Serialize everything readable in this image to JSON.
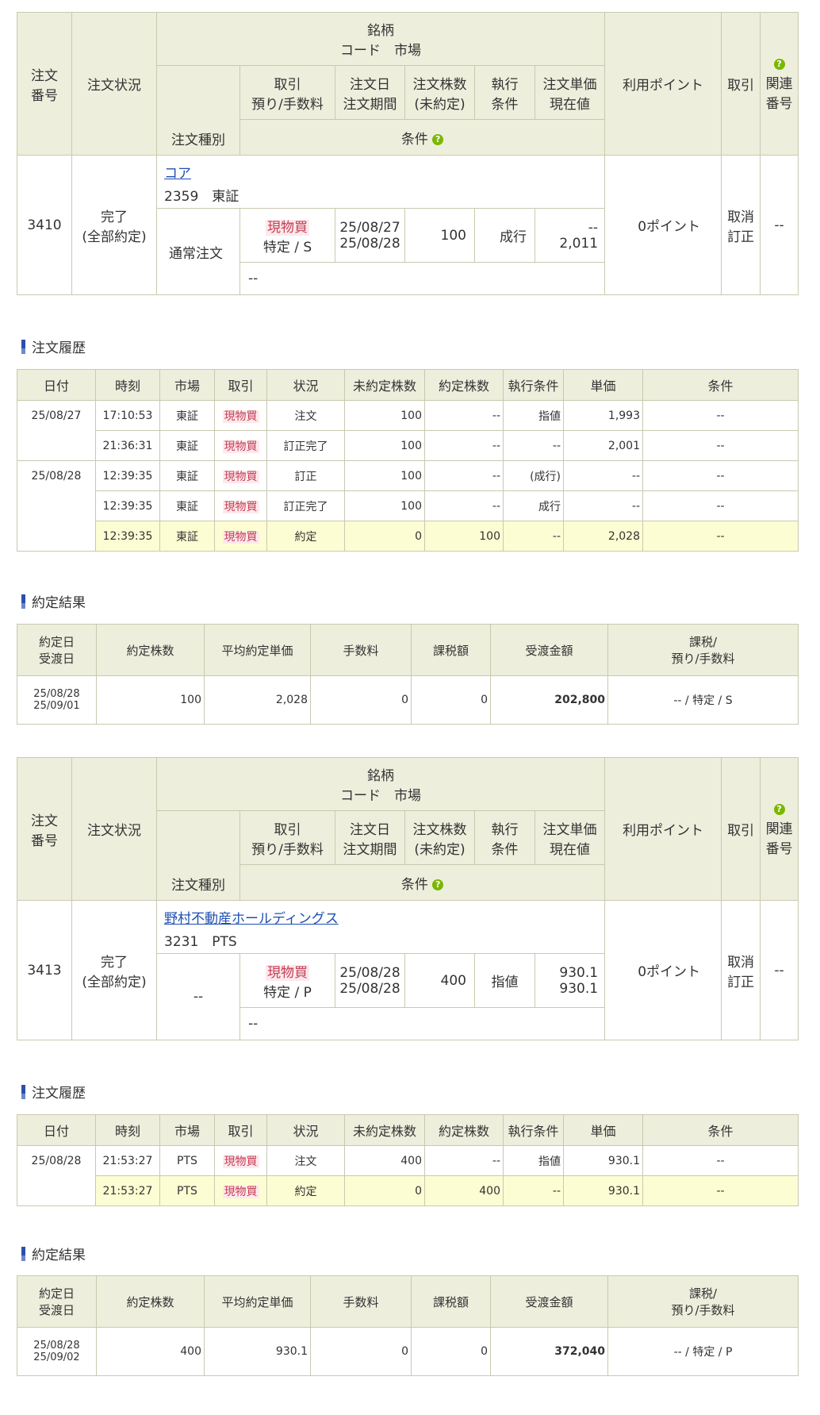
{
  "order_headers": {
    "order_no": "注文\n番号",
    "status": "注文状況",
    "brand": "銘柄",
    "code_market": "コード　市場",
    "order_type": "注文種別",
    "trade": "取引\n預り/手数料",
    "order_date": "注文日\n注文期間",
    "qty": "注文株数\n(未約定)",
    "exec": "執行\n条件",
    "price": "注文単価\n現在値",
    "points": "利用ポイント",
    "cancel": "取引",
    "related": "関連\n番号",
    "condition": "条件"
  },
  "history_title": "注文履歴",
  "result_title": "約定結果",
  "history_headers": [
    "日付",
    "時刻",
    "市場",
    "取引",
    "状況",
    "未約定株数",
    "約定株数",
    "執行条件",
    "単価",
    "条件"
  ],
  "result_headers": [
    "約定日\n受渡日",
    "約定株数",
    "平均約定単価",
    "手数料",
    "課税額",
    "受渡金額",
    "課税/\n預り/手数料"
  ],
  "orders": [
    {
      "order_no": "3410",
      "status": "完了\n(全部約定)",
      "brand_name": "コア",
      "brand_code_market": "2359　東証",
      "order_type": "通常注文",
      "trade": "現物買",
      "account": "特定 / S",
      "order_date": "25/08/27\n25/08/28",
      "qty": "100",
      "exec": "成行",
      "price": "--\n2,011",
      "points": "0ポイント",
      "cancel": "取消\n訂正",
      "related": "--",
      "condition": "--",
      "history": [
        {
          "date": "25/08/27",
          "time": "17:10:53",
          "market": "東証",
          "trade": "現物買",
          "status": "注文",
          "unfilled": "100",
          "filled": "--",
          "exec": "指値",
          "price": "1,993",
          "cond": "--",
          "yellow": false
        },
        {
          "date": "",
          "time": "21:36:31",
          "market": "東証",
          "trade": "現物買",
          "status": "訂正完了",
          "unfilled": "100",
          "filled": "--",
          "exec": "--",
          "price": "2,001",
          "cond": "--",
          "yellow": false
        },
        {
          "date": "25/08/28",
          "time": "12:39:35",
          "market": "東証",
          "trade": "現物買",
          "status": "訂正",
          "unfilled": "100",
          "filled": "--",
          "exec": "(成行)",
          "price": "--",
          "cond": "--",
          "yellow": false
        },
        {
          "date": "",
          "time": "12:39:35",
          "market": "東証",
          "trade": "現物買",
          "status": "訂正完了",
          "unfilled": "100",
          "filled": "--",
          "exec": "成行",
          "price": "--",
          "cond": "--",
          "yellow": false
        },
        {
          "date": "",
          "time": "12:39:35",
          "market": "東証",
          "trade": "現物買",
          "status": "約定",
          "unfilled": "0",
          "filled": "100",
          "exec": "--",
          "price": "2,028",
          "cond": "--",
          "yellow": true
        }
      ],
      "result": {
        "dates": "25/08/28\n25/09/01",
        "qty": "100",
        "avg_price": "2,028",
        "fee": "0",
        "tax": "0",
        "amount": "202,800",
        "account": "-- / 特定 / S"
      }
    },
    {
      "order_no": "3413",
      "status": "完了\n(全部約定)",
      "brand_name": "野村不動産ホールディングス",
      "brand_code_market": "3231　PTS",
      "order_type": "--",
      "trade": "現物買",
      "account": "特定 / P",
      "order_date": "25/08/28\n25/08/28",
      "qty": "400",
      "exec": "指値",
      "price": "930.1\n930.1",
      "points": "0ポイント",
      "cancel": "取消\n訂正",
      "related": "--",
      "condition": "--",
      "history": [
        {
          "date": "25/08/28",
          "time": "21:53:27",
          "market": "PTS",
          "trade": "現物買",
          "status": "注文",
          "unfilled": "400",
          "filled": "--",
          "exec": "指値",
          "price": "930.1",
          "cond": "--",
          "yellow": false
        },
        {
          "date": "",
          "time": "21:53:27",
          "market": "PTS",
          "trade": "現物買",
          "status": "約定",
          "unfilled": "0",
          "filled": "400",
          "exec": "--",
          "price": "930.1",
          "cond": "--",
          "yellow": true
        }
      ],
      "result": {
        "dates": "25/08/28\n25/09/02",
        "qty": "400",
        "avg_price": "930.1",
        "fee": "0",
        "tax": "0",
        "amount": "372,040",
        "account": "-- / 特定 / P"
      }
    }
  ]
}
